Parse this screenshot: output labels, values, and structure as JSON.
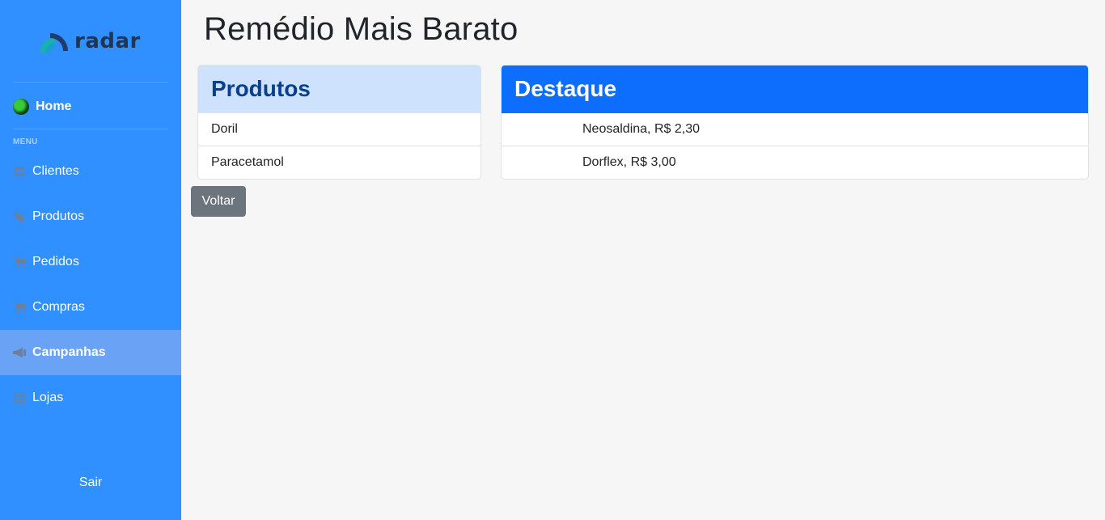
{
  "brand": {
    "name": "radar"
  },
  "sidebar": {
    "home_label": "Home",
    "menu_heading": "MENU",
    "items": [
      {
        "label": "Clientes",
        "icon": "users-icon",
        "active": false
      },
      {
        "label": "Produtos",
        "icon": "tag-icon",
        "active": false
      },
      {
        "label": "Pedidos",
        "icon": "cart-icon",
        "active": false
      },
      {
        "label": "Compras",
        "icon": "cart-icon",
        "active": false
      },
      {
        "label": "Campanhas",
        "icon": "megaphone-icon",
        "active": true
      },
      {
        "label": "Lojas",
        "icon": "store-icon",
        "active": false
      }
    ],
    "logout_label": "Sair"
  },
  "main": {
    "title": "Remédio Mais Barato",
    "produtos": {
      "header": "Produtos",
      "items": [
        "Doril",
        "Paracetamol"
      ]
    },
    "destaque": {
      "header": "Destaque",
      "items": [
        "Neosaldina, R$ 2,30",
        "Dorflex, R$ 3,00"
      ]
    },
    "back_button": "Voltar"
  },
  "colors": {
    "sidebar_bg": "#3090ff",
    "sidebar_active": "#6aa3f5",
    "produtos_header_bg": "#cfe2fd",
    "produtos_header_text": "#0a3f8c",
    "destaque_header_bg": "#0d6efd",
    "button_secondary": "#6c757d"
  }
}
